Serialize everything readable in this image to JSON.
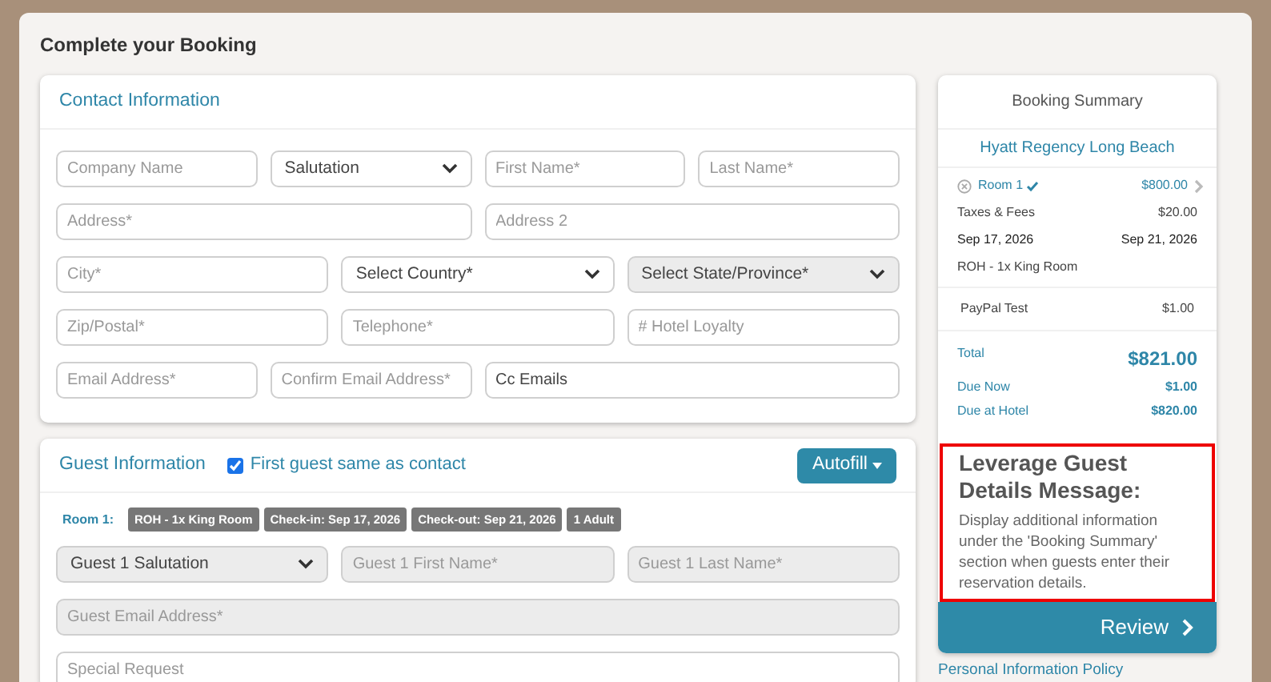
{
  "page_title": "Complete your Booking",
  "contact": {
    "title": "Contact Information",
    "rows": [
      [
        {
          "kind": "input",
          "placeholder": "Company Name",
          "disabled": false
        },
        {
          "kind": "select",
          "value": "Salutation",
          "disabled": false
        },
        {
          "kind": "input",
          "placeholder": "First Name*",
          "disabled": false
        },
        {
          "kind": "input",
          "placeholder": "Last Name*",
          "disabled": false
        }
      ],
      [
        {
          "kind": "input",
          "placeholder": "Address*",
          "disabled": false
        },
        {
          "kind": "input",
          "placeholder": "Address 2",
          "disabled": false
        }
      ],
      [
        {
          "kind": "input",
          "placeholder": "City*",
          "disabled": false
        },
        {
          "kind": "select",
          "value": "Select Country*",
          "disabled": false
        },
        {
          "kind": "select",
          "value": "Select State/Province*",
          "disabled": true
        }
      ],
      [
        {
          "kind": "input",
          "placeholder": "Zip/Postal*",
          "disabled": false
        },
        {
          "kind": "input",
          "placeholder": "Telephone*",
          "disabled": false
        },
        {
          "kind": "input",
          "placeholder": "# Hotel Loyalty",
          "disabled": false
        }
      ],
      [
        {
          "kind": "input",
          "placeholder": "Email Address*",
          "disabled": false
        },
        {
          "kind": "input",
          "placeholder": "Confirm Email Address*",
          "disabled": false
        },
        {
          "kind": "input",
          "value": "Cc Emails",
          "disabled": false
        }
      ]
    ]
  },
  "guest": {
    "title": "Guest Information",
    "same_as_contact": {
      "label": "First guest same as contact",
      "checked": true
    },
    "autofill": "Autofill",
    "room_label": "Room 1:",
    "badges": [
      "ROH - 1x King Room",
      "Check-in: Sep 17, 2026",
      "Check-out: Sep 21, 2026",
      "1 Adult"
    ],
    "rows": [
      [
        {
          "kind": "select",
          "value": "Guest 1 Salutation",
          "disabled": true
        },
        {
          "kind": "input",
          "placeholder": "Guest 1 First Name*",
          "disabled": true
        },
        {
          "kind": "input",
          "placeholder": "Guest 1 Last Name*",
          "disabled": true
        }
      ],
      [
        {
          "kind": "input",
          "placeholder": "Guest Email Address*",
          "disabled": true
        }
      ],
      [
        {
          "kind": "input",
          "placeholder": "Special Request",
          "disabled": false
        }
      ]
    ]
  },
  "summary": {
    "title": "Booking Summary",
    "hotel": "Hyatt Regency Long Beach",
    "room": {
      "name": "Room 1",
      "price": "$800.00",
      "taxes_label": "Taxes & Fees",
      "taxes": "$20.00",
      "check_in": "Sep 17, 2026",
      "check_out": "Sep 21, 2026",
      "type": "ROH - 1x King Room"
    },
    "extras": [
      {
        "label": "PayPal Test",
        "amount": "$1.00"
      }
    ],
    "totals": [
      {
        "label": "Total",
        "amount": "$821.00",
        "kind": "total"
      },
      {
        "label": "Due Now",
        "amount": "$1.00",
        "kind": "due"
      },
      {
        "label": "Due at Hotel",
        "amount": "$820.00",
        "kind": "due"
      }
    ],
    "message": {
      "heading": "Leverage Guest Details Message:",
      "body": "Display additional information under the 'Booking Summary' section when guests enter their reservation details."
    },
    "review": "Review"
  },
  "policy_link": "Personal Information Policy"
}
